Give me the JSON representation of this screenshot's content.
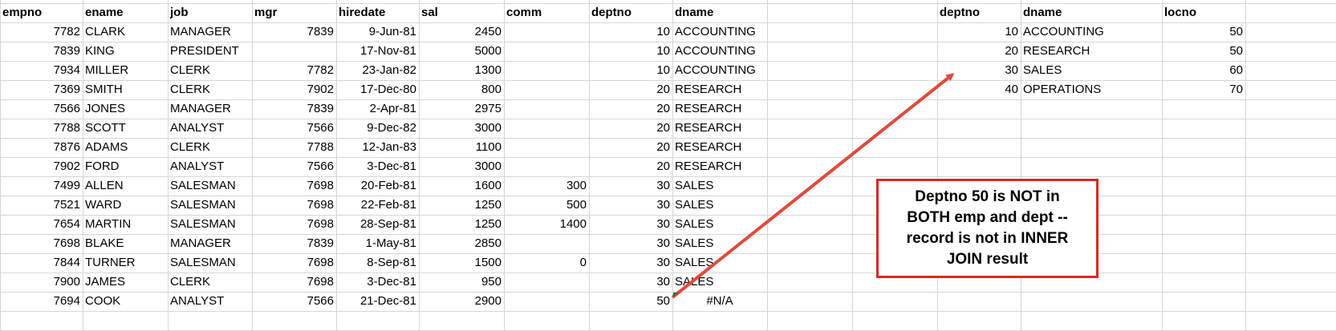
{
  "emp_table": {
    "headers": [
      "empno",
      "ename",
      "job",
      "mgr",
      "hiredate",
      "sal",
      "comm",
      "deptno",
      "dname"
    ],
    "rows": [
      [
        "7782",
        "CLARK",
        "MANAGER",
        "7839",
        "9-Jun-81",
        "2450",
        "",
        "10",
        "ACCOUNTING"
      ],
      [
        "7839",
        "KING",
        "PRESIDENT",
        "",
        "17-Nov-81",
        "5000",
        "",
        "10",
        "ACCOUNTING"
      ],
      [
        "7934",
        "MILLER",
        "CLERK",
        "7782",
        "23-Jan-82",
        "1300",
        "",
        "10",
        "ACCOUNTING"
      ],
      [
        "7369",
        "SMITH",
        "CLERK",
        "7902",
        "17-Dec-80",
        "800",
        "",
        "20",
        "RESEARCH"
      ],
      [
        "7566",
        "JONES",
        "MANAGER",
        "7839",
        "2-Apr-81",
        "2975",
        "",
        "20",
        "RESEARCH"
      ],
      [
        "7788",
        "SCOTT",
        "ANALYST",
        "7566",
        "9-Dec-82",
        "3000",
        "",
        "20",
        "RESEARCH"
      ],
      [
        "7876",
        "ADAMS",
        "CLERK",
        "7788",
        "12-Jan-83",
        "1100",
        "",
        "20",
        "RESEARCH"
      ],
      [
        "7902",
        "FORD",
        "ANALYST",
        "7566",
        "3-Dec-81",
        "3000",
        "",
        "20",
        "RESEARCH"
      ],
      [
        "7499",
        "ALLEN",
        "SALESMAN",
        "7698",
        "20-Feb-81",
        "1600",
        "300",
        "30",
        "SALES"
      ],
      [
        "7521",
        "WARD",
        "SALESMAN",
        "7698",
        "22-Feb-81",
        "1250",
        "500",
        "30",
        "SALES"
      ],
      [
        "7654",
        "MARTIN",
        "SALESMAN",
        "7698",
        "28-Sep-81",
        "1250",
        "1400",
        "30",
        "SALES"
      ],
      [
        "7698",
        "BLAKE",
        "MANAGER",
        "7839",
        "1-May-81",
        "2850",
        "",
        "30",
        "SALES"
      ],
      [
        "7844",
        "TURNER",
        "SALESMAN",
        "7698",
        "8-Sep-81",
        "1500",
        "0",
        "30",
        "SALES"
      ],
      [
        "7900",
        "JAMES",
        "CLERK",
        "7698",
        "3-Dec-81",
        "950",
        "",
        "30",
        "SALES"
      ],
      [
        "7694",
        "COOK",
        "ANALYST",
        "7566",
        "21-Dec-81",
        "2900",
        "",
        "50",
        "#N/A"
      ]
    ]
  },
  "dept_table": {
    "headers": [
      "deptno",
      "dname",
      "locno"
    ],
    "rows": [
      [
        "10",
        "ACCOUNTING",
        "50"
      ],
      [
        "20",
        "RESEARCH",
        "50"
      ],
      [
        "30",
        "SALES",
        "60"
      ],
      [
        "40",
        "OPERATIONS",
        "70"
      ]
    ]
  },
  "callout": {
    "text": "Deptno 50 is NOT in BOTH emp and dept -- record is not in INNER JOIN result",
    "border_color": "#e02424"
  },
  "colors": {
    "gridline": "#d6d6d6",
    "arrow": "#e04a3c",
    "error_indicator": "#1e7b34"
  }
}
